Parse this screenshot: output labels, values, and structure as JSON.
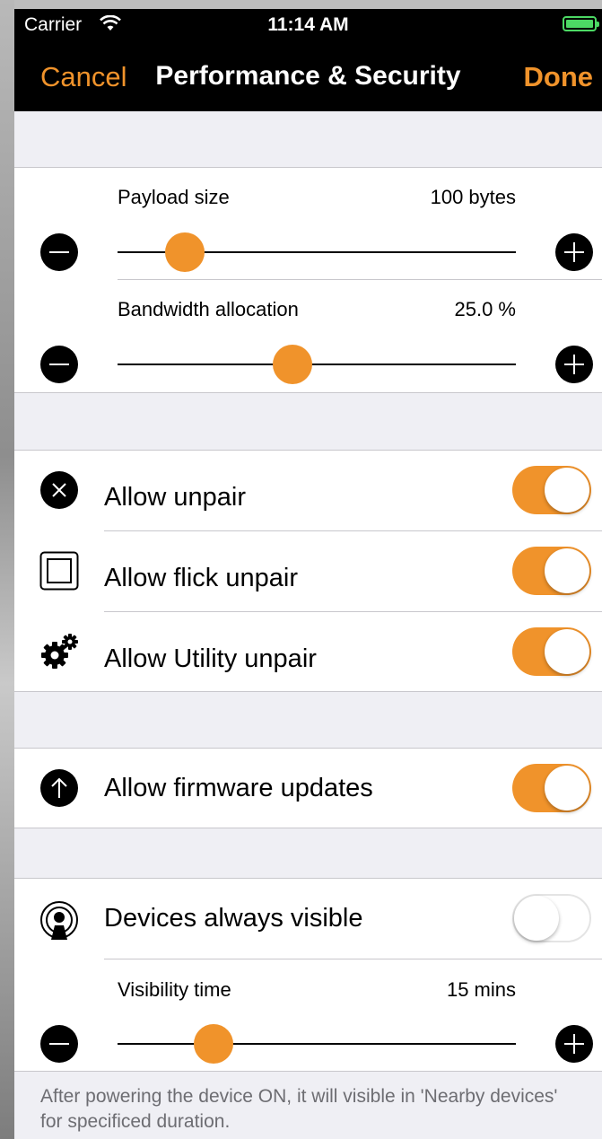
{
  "status_bar": {
    "carrier": "Carrier",
    "time": "11:14 AM"
  },
  "nav": {
    "cancel": "Cancel",
    "title": "Performance & Security",
    "done": "Done"
  },
  "sliders": {
    "payload": {
      "label": "Payload size",
      "value": "100 bytes",
      "level": 0.17
    },
    "bandwidth": {
      "label": "Bandwidth allocation",
      "value": "25.0 %",
      "level": 0.44
    },
    "visibility": {
      "label": "Visibility time",
      "value": "15 mins",
      "level": 0.24
    }
  },
  "toggles": {
    "unpair": {
      "label": "Allow unpair",
      "on": true,
      "icon": "close-circle-icon"
    },
    "flick": {
      "label": "Allow flick unpair",
      "on": true,
      "icon": "square-icon"
    },
    "utility": {
      "label": "Allow Utility unpair",
      "on": true,
      "icon": "gears-icon"
    },
    "firmware": {
      "label": "Allow firmware updates",
      "on": true,
      "icon": "arrow-up-circle-icon"
    },
    "visible": {
      "label": "Devices always visible",
      "on": false,
      "icon": "broadcast-icon"
    }
  },
  "footer": "After powering the device ON, it will visible in 'Nearby devices' for specificed duration.",
  "colors": {
    "accent": "#f0932b",
    "battery": "#4cd964",
    "background": "#efeff4"
  }
}
